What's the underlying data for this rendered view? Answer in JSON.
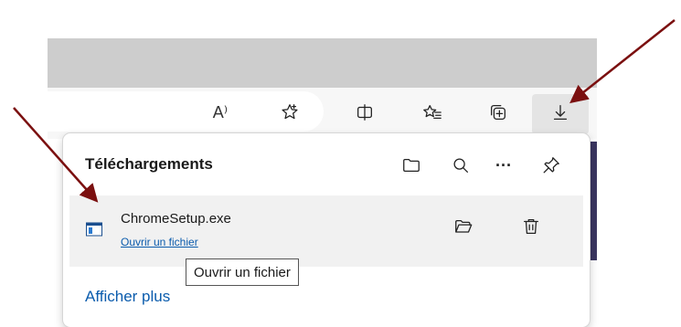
{
  "toolbar": {
    "read_aloud_label": "A⁾",
    "icons": [
      "read-aloud-icon",
      "favorite-star-icon",
      "split-screen-icon",
      "favorites-icon",
      "collections-icon",
      "download-icon"
    ]
  },
  "panel": {
    "title": "Téléchargements",
    "header_icons": [
      "folder-icon",
      "search-icon",
      "more-icon",
      "pin-icon"
    ],
    "more_glyph": "···",
    "item": {
      "file_name": "ChromeSetup.exe",
      "action_link": "Ouvrir un fichier",
      "icons": [
        "open-folder-icon",
        "delete-icon"
      ]
    },
    "tooltip": "Ouvrir un fichier",
    "footer_link": "Afficher plus"
  },
  "colors": {
    "accent_link": "#0b5cad",
    "arrow": "#7b1010",
    "title_bar": "#cdcdcd",
    "row_highlight": "#f1f1f1"
  }
}
